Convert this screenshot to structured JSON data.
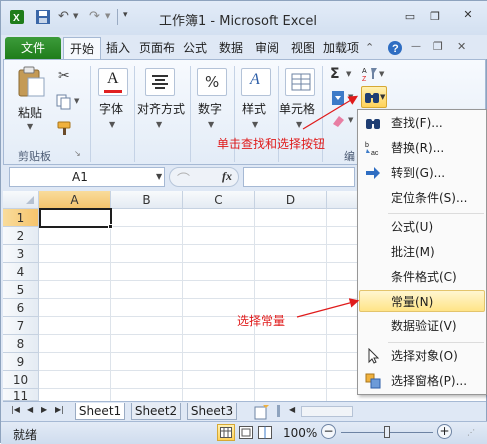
{
  "window": {
    "title": "工作簿1 - Microsoft Excel"
  },
  "ribbon": {
    "tabs": [
      "文件",
      "开始",
      "插入",
      "页面布",
      "公式",
      "数据",
      "审阅",
      "视图",
      "加载项"
    ],
    "groups": {
      "paste_label": "粘贴",
      "clipboard_label": "剪贴板",
      "font_label": "字体",
      "align_label": "对齐方式",
      "number_label": "数字",
      "styles_label": "样式",
      "cells_label": "单元格",
      "editing_label": "编"
    }
  },
  "formula_bar": {
    "name_box": "A1",
    "fx": "fx"
  },
  "grid": {
    "columns": [
      "A",
      "B",
      "C",
      "D"
    ],
    "rows": [
      "1",
      "2",
      "3",
      "4",
      "5",
      "6",
      "7",
      "8",
      "9",
      "10",
      "11"
    ]
  },
  "sheets": [
    "Sheet1",
    "Sheet2",
    "Sheet3"
  ],
  "status": {
    "ready": "就绪",
    "zoom": "100%"
  },
  "menu": {
    "items": [
      {
        "label": "查找(F)...",
        "icon": "binoculars-icon"
      },
      {
        "label": "替换(R)...",
        "icon": "replace-icon"
      },
      {
        "label": "转到(G)...",
        "icon": "arrow-right-icon"
      },
      {
        "label": "定位条件(S)...",
        "icon": ""
      },
      {
        "label": "公式(U)",
        "icon": ""
      },
      {
        "label": "批注(M)",
        "icon": ""
      },
      {
        "label": "条件格式(C)",
        "icon": ""
      },
      {
        "label": "常量(N)",
        "icon": ""
      },
      {
        "label": "数据验证(V)",
        "icon": ""
      },
      {
        "label": "选择对象(O)",
        "icon": "cursor-icon"
      },
      {
        "label": "选择窗格(P)...",
        "icon": "selection-pane-icon"
      }
    ]
  },
  "annotations": {
    "find_select": "单击查找和选择按钮",
    "constants": "选择常量"
  },
  "colors": {
    "file_tab": "#2a8a26",
    "annotation": "#e01b1b",
    "highlight": "#ffe487"
  }
}
